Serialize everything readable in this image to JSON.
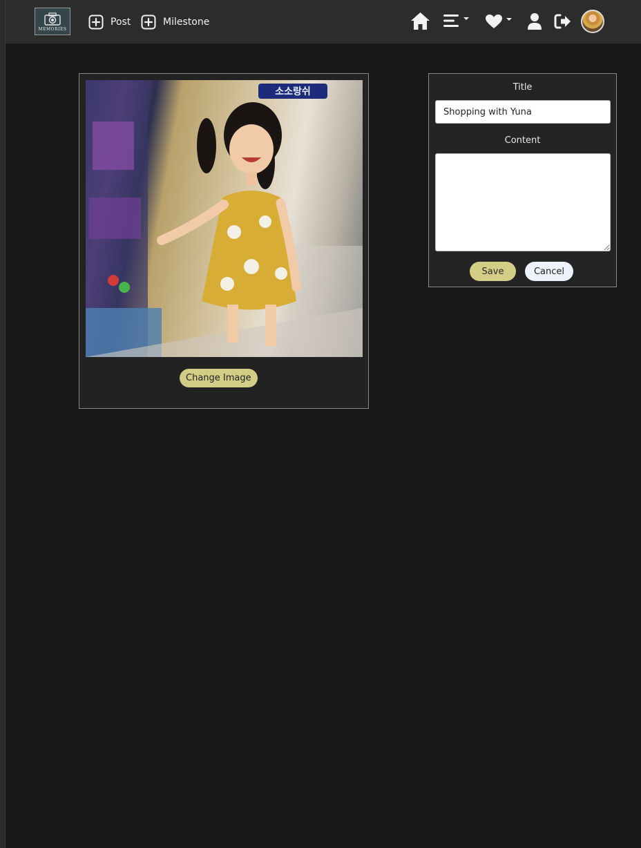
{
  "nav": {
    "logo_text": "MEMORIES",
    "post_label": "Post",
    "milestone_label": "Milestone",
    "icons": [
      "home-icon",
      "menu-icon",
      "heart-icon",
      "user-icon",
      "logout-icon"
    ]
  },
  "image_card": {
    "photo_sign_text": "소소랑쉬",
    "change_image_label": "Change Image"
  },
  "form": {
    "title_label": "Title",
    "title_value": "Shopping with Yuna",
    "content_label": "Content",
    "content_value": "",
    "save_label": "Save",
    "cancel_label": "Cancel"
  },
  "colors": {
    "background": "#181818",
    "navbar": "#2c2c2c",
    "accent_button": "#d3cd86",
    "cancel_button": "#eef2fa"
  }
}
